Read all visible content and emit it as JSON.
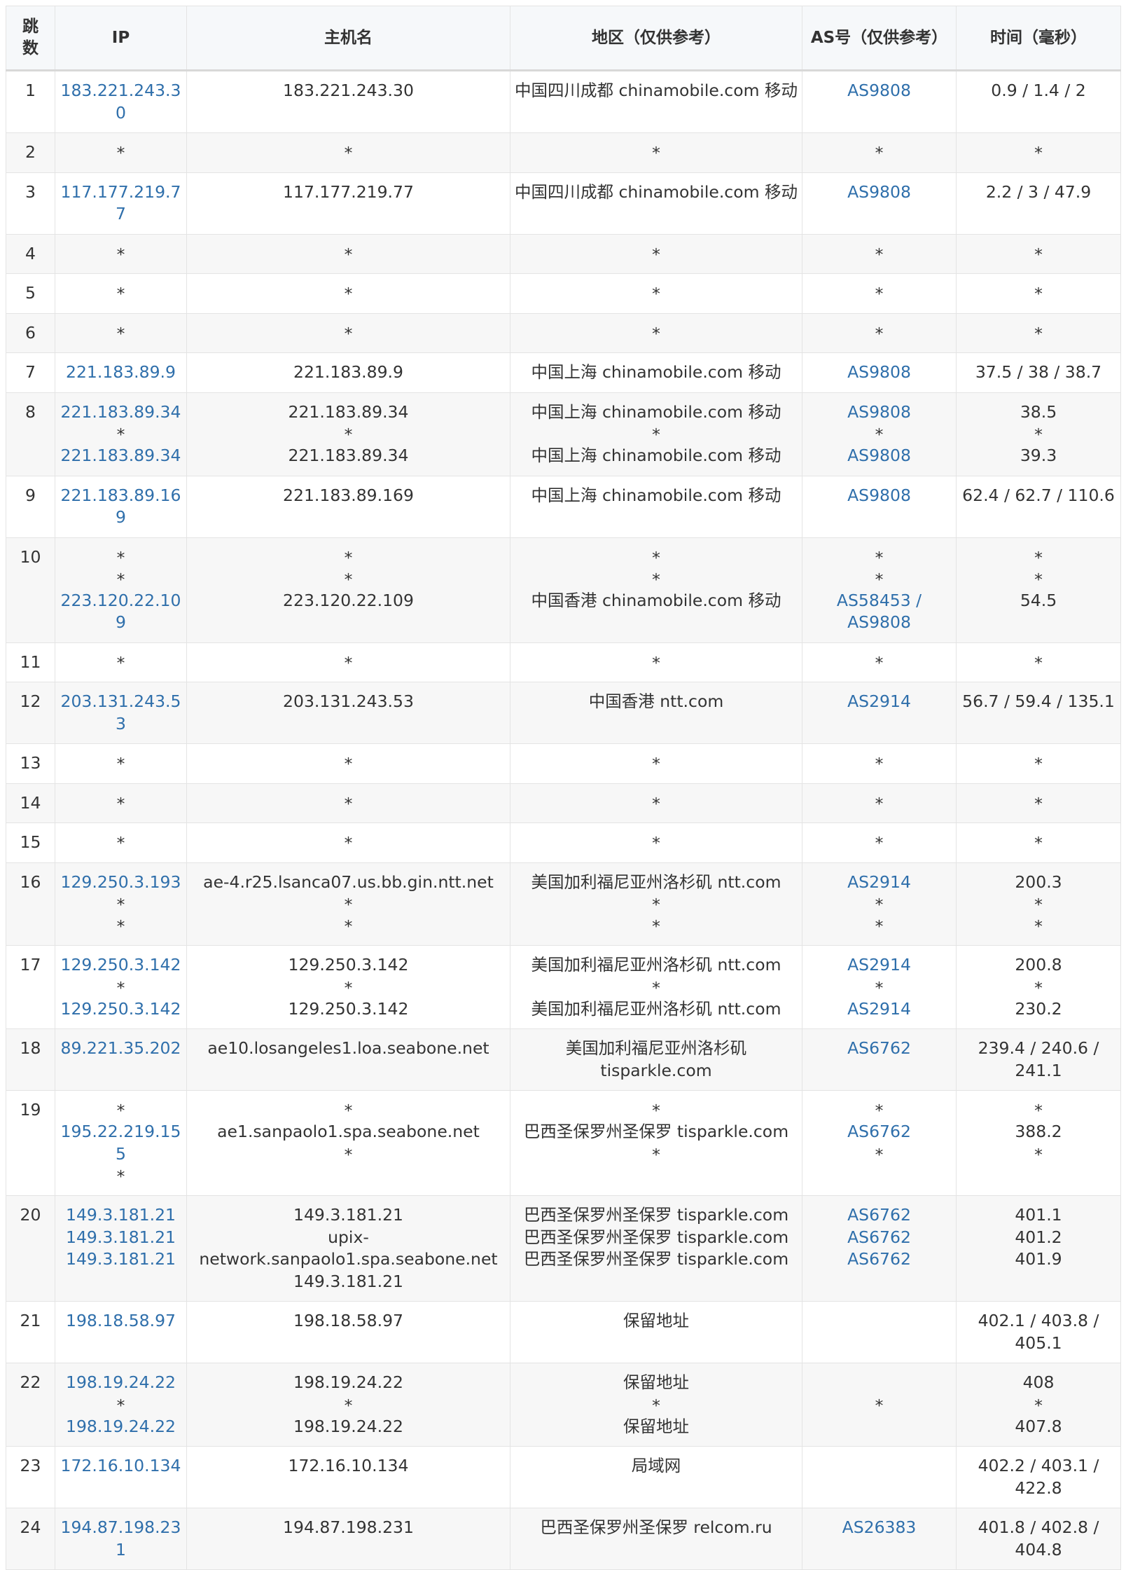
{
  "headers": {
    "hop": "跳数",
    "ip": "IP",
    "host": "主机名",
    "region": "地区（仅供参考）",
    "as": "AS号（仅供参考）",
    "time": "时间（毫秒）"
  },
  "rows": [
    {
      "hop": "1",
      "ip": [
        "183.221.243.30"
      ],
      "host": [
        "183.221.243.30"
      ],
      "region": [
        "中国四川成都 chinamobile.com 移动"
      ],
      "as": [
        "AS9808"
      ],
      "time": [
        "0.9 / 1.4 / 2"
      ]
    },
    {
      "hop": "2",
      "ip": [
        "*"
      ],
      "host": [
        "*"
      ],
      "region": [
        "*"
      ],
      "as": [
        "*"
      ],
      "time": [
        "*"
      ]
    },
    {
      "hop": "3",
      "ip": [
        "117.177.219.77"
      ],
      "host": [
        "117.177.219.77"
      ],
      "region": [
        "中国四川成都 chinamobile.com 移动"
      ],
      "as": [
        "AS9808"
      ],
      "time": [
        "2.2 / 3 / 47.9"
      ]
    },
    {
      "hop": "4",
      "ip": [
        "*"
      ],
      "host": [
        "*"
      ],
      "region": [
        "*"
      ],
      "as": [
        "*"
      ],
      "time": [
        "*"
      ]
    },
    {
      "hop": "5",
      "ip": [
        "*"
      ],
      "host": [
        "*"
      ],
      "region": [
        "*"
      ],
      "as": [
        "*"
      ],
      "time": [
        "*"
      ]
    },
    {
      "hop": "6",
      "ip": [
        "*"
      ],
      "host": [
        "*"
      ],
      "region": [
        "*"
      ],
      "as": [
        "*"
      ],
      "time": [
        "*"
      ]
    },
    {
      "hop": "7",
      "ip": [
        "221.183.89.9"
      ],
      "host": [
        "221.183.89.9"
      ],
      "region": [
        "中国上海 chinamobile.com 移动"
      ],
      "as": [
        "AS9808"
      ],
      "time": [
        "37.5 / 38 / 38.7"
      ]
    },
    {
      "hop": "8",
      "ip": [
        "221.183.89.34",
        "*",
        "221.183.89.34"
      ],
      "host": [
        "221.183.89.34",
        "*",
        "221.183.89.34"
      ],
      "region": [
        "中国上海 chinamobile.com 移动",
        "*",
        "中国上海 chinamobile.com 移动"
      ],
      "as": [
        "AS9808",
        "*",
        "AS9808"
      ],
      "time": [
        "38.5",
        "*",
        "39.3"
      ]
    },
    {
      "hop": "9",
      "ip": [
        "221.183.89.169"
      ],
      "host": [
        "221.183.89.169"
      ],
      "region": [
        "中国上海 chinamobile.com 移动"
      ],
      "as": [
        "AS9808"
      ],
      "time": [
        "62.4 / 62.7 / 110.6"
      ]
    },
    {
      "hop": "10",
      "ip": [
        "*",
        "*",
        "223.120.22.109"
      ],
      "host": [
        "*",
        "*",
        "223.120.22.109"
      ],
      "region": [
        "*",
        "*",
        "中国香港 chinamobile.com 移动"
      ],
      "as": [
        "*",
        "*",
        "AS58453 / AS9808"
      ],
      "time": [
        "*",
        "*",
        "54.5"
      ]
    },
    {
      "hop": "11",
      "ip": [
        "*"
      ],
      "host": [
        "*"
      ],
      "region": [
        "*"
      ],
      "as": [
        "*"
      ],
      "time": [
        "*"
      ]
    },
    {
      "hop": "12",
      "ip": [
        "203.131.243.53"
      ],
      "host": [
        "203.131.243.53"
      ],
      "region": [
        "中国香港 ntt.com"
      ],
      "as": [
        "AS2914"
      ],
      "time": [
        "56.7 / 59.4 / 135.1"
      ]
    },
    {
      "hop": "13",
      "ip": [
        "*"
      ],
      "host": [
        "*"
      ],
      "region": [
        "*"
      ],
      "as": [
        "*"
      ],
      "time": [
        "*"
      ]
    },
    {
      "hop": "14",
      "ip": [
        "*"
      ],
      "host": [
        "*"
      ],
      "region": [
        "*"
      ],
      "as": [
        "*"
      ],
      "time": [
        "*"
      ]
    },
    {
      "hop": "15",
      "ip": [
        "*"
      ],
      "host": [
        "*"
      ],
      "region": [
        "*"
      ],
      "as": [
        "*"
      ],
      "time": [
        "*"
      ]
    },
    {
      "hop": "16",
      "ip": [
        "129.250.3.193",
        "*",
        "*"
      ],
      "host": [
        "ae-4.r25.lsanca07.us.bb.gin.ntt.net",
        "*",
        "*"
      ],
      "region": [
        "美国加利福尼亚州洛杉矶 ntt.com",
        "*",
        "*"
      ],
      "as": [
        "AS2914",
        "*",
        "*"
      ],
      "time": [
        "200.3",
        "*",
        "*"
      ]
    },
    {
      "hop": "17",
      "ip": [
        "129.250.3.142",
        "*",
        "129.250.3.142"
      ],
      "host": [
        "129.250.3.142",
        "*",
        "129.250.3.142"
      ],
      "region": [
        "美国加利福尼亚州洛杉矶 ntt.com",
        "*",
        "美国加利福尼亚州洛杉矶 ntt.com"
      ],
      "as": [
        "AS2914",
        "*",
        "AS2914"
      ],
      "time": [
        "200.8",
        "*",
        "230.2"
      ]
    },
    {
      "hop": "18",
      "ip": [
        "89.221.35.202"
      ],
      "host": [
        "ae10.losangeles1.loa.seabone.net"
      ],
      "region": [
        "美国加利福尼亚州洛杉矶 tisparkle.com"
      ],
      "as": [
        "AS6762"
      ],
      "time": [
        "239.4 / 240.6 / 241.1"
      ]
    },
    {
      "hop": "19",
      "ip": [
        "*",
        "195.22.219.155",
        "*"
      ],
      "host": [
        "*",
        "ae1.sanpaolo1.spa.seabone.net",
        "*"
      ],
      "region": [
        "*",
        "巴西圣保罗州圣保罗 tisparkle.com",
        "*"
      ],
      "as": [
        "*",
        "AS6762",
        "*"
      ],
      "time": [
        "*",
        "388.2",
        "*"
      ]
    },
    {
      "hop": "20",
      "ip": [
        "149.3.181.21",
        "149.3.181.21",
        "149.3.181.21"
      ],
      "host": [
        "149.3.181.21",
        "upix-network.sanpaolo1.spa.seabone.net",
        "149.3.181.21"
      ],
      "region": [
        "巴西圣保罗州圣保罗 tisparkle.com",
        "巴西圣保罗州圣保罗 tisparkle.com",
        "巴西圣保罗州圣保罗 tisparkle.com"
      ],
      "as": [
        "AS6762",
        "AS6762",
        "AS6762"
      ],
      "time": [
        "401.1",
        "401.2",
        "401.9"
      ]
    },
    {
      "hop": "21",
      "ip": [
        "198.18.58.97"
      ],
      "host": [
        "198.18.58.97"
      ],
      "region": [
        "保留地址"
      ],
      "as": [],
      "time": [
        "402.1 / 403.8 / 405.1"
      ]
    },
    {
      "hop": "22",
      "ip": [
        "198.19.24.22",
        "*",
        "198.19.24.22"
      ],
      "host": [
        "198.19.24.22",
        "*",
        "198.19.24.22"
      ],
      "region": [
        "保留地址",
        "*",
        "保留地址"
      ],
      "as": [
        "*"
      ],
      "time": [
        "408",
        "*",
        "407.8"
      ]
    },
    {
      "hop": "23",
      "ip": [
        "172.16.10.134"
      ],
      "host": [
        "172.16.10.134"
      ],
      "region": [
        "局域网"
      ],
      "as": [],
      "time": [
        "402.2 / 403.1 / 422.8"
      ]
    },
    {
      "hop": "24",
      "ip": [
        "194.87.198.231"
      ],
      "host": [
        "194.87.198.231"
      ],
      "region": [
        "巴西圣保罗州圣保罗 relcom.ru"
      ],
      "as": [
        "AS26383"
      ],
      "time": [
        "401.8 / 402.8 / 404.8"
      ]
    }
  ]
}
